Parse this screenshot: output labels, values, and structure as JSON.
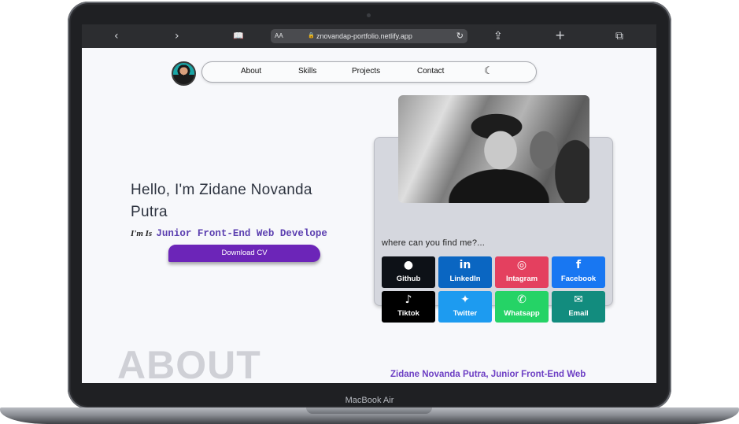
{
  "device": {
    "label": "MacBook Air"
  },
  "browser": {
    "back_icon": "‹",
    "forward_icon": "›",
    "reader_icon": "📖",
    "text_size": "AA",
    "url": "znovandap-portfolio.netlify.app",
    "reload_icon": "↻",
    "share_icon": "⇪",
    "new_tab_icon": "+",
    "tabs_icon": "⧉"
  },
  "nav": {
    "items": [
      {
        "label": "About"
      },
      {
        "label": "Skills"
      },
      {
        "label": "Projects"
      },
      {
        "label": "Contact"
      }
    ],
    "theme_icon": "☾"
  },
  "hero": {
    "greeting": "Hello, I'm Zidane Novanda Putra",
    "prefix": "I'm Is",
    "typed_text": "Junior Front-End Web Develope",
    "cv_button": "Download CV"
  },
  "contact_card": {
    "heading": "where can you find me?...",
    "links": [
      {
        "label": "Github",
        "icon": "github-icon",
        "glyph": "●",
        "color": "#0d1117"
      },
      {
        "label": "LinkedIn",
        "icon": "linkedin-icon",
        "glyph": "in",
        "color": "#0a66c2"
      },
      {
        "label": "Intagram",
        "icon": "instagram-icon",
        "glyph": "◎",
        "color": "#e4405f"
      },
      {
        "label": "Facebook",
        "icon": "facebook-icon",
        "glyph": "f",
        "color": "#1877f2"
      },
      {
        "label": "Tiktok",
        "icon": "tiktok-icon",
        "glyph": "♪",
        "color": "#000000"
      },
      {
        "label": "Twitter",
        "icon": "twitter-icon",
        "glyph": "✦",
        "color": "#1d9bf0"
      },
      {
        "label": "Whatsapp",
        "icon": "whatsapp-icon",
        "glyph": "✆",
        "color": "#25d366"
      },
      {
        "label": "Email",
        "icon": "email-icon",
        "glyph": "✉",
        "color": "#128c7e"
      }
    ]
  },
  "about": {
    "heading": "ABOUT",
    "subtitle": "Zidane Novanda Putra, Junior Front-End Web"
  }
}
